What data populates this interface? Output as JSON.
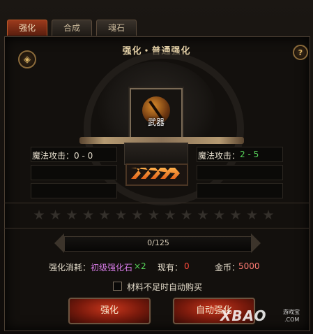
{
  "tabs": [
    {
      "label": "强化",
      "active": true
    },
    {
      "label": "合成",
      "active": false
    },
    {
      "label": "魂石",
      "active": false
    }
  ],
  "title": "强化・普通强化",
  "left_icon": "ingot-icon",
  "help_icon": "?",
  "slot": {
    "label": "武器",
    "icon": "weapon-orb-icon"
  },
  "stats": {
    "left_label": "魔法攻击：0 - 0",
    "right_label": "魔法攻击：",
    "right_value": "2 - 5"
  },
  "stars": [
    "★",
    "★",
    "★",
    "★",
    "★",
    "★",
    "★",
    "★",
    "★",
    "★",
    "★",
    "★",
    "★",
    "★",
    "★"
  ],
  "progress": {
    "text": "0/125",
    "current": 0,
    "max": 125
  },
  "cost": {
    "label": "强化消耗：",
    "item": "初级强化石",
    "multiplier": "×2",
    "have_label": "现有：",
    "have_value": "0",
    "gold_label": "金币：",
    "gold_value": "5000"
  },
  "auto_buy": {
    "label": "材料不足时自动购买",
    "checked": false
  },
  "buttons": {
    "enhance": "强化",
    "auto_enhance": "自动强化"
  },
  "watermark": {
    "logo": "XBAO",
    "sub": "游戏宝",
    "com": ".COM"
  },
  "colors": {
    "accent_red": "#c8361c",
    "stat_green": "#57d35a",
    "item_purple": "#d67be6",
    "value_red": "#ff4a3a",
    "gold_value": "#ff7b73"
  }
}
